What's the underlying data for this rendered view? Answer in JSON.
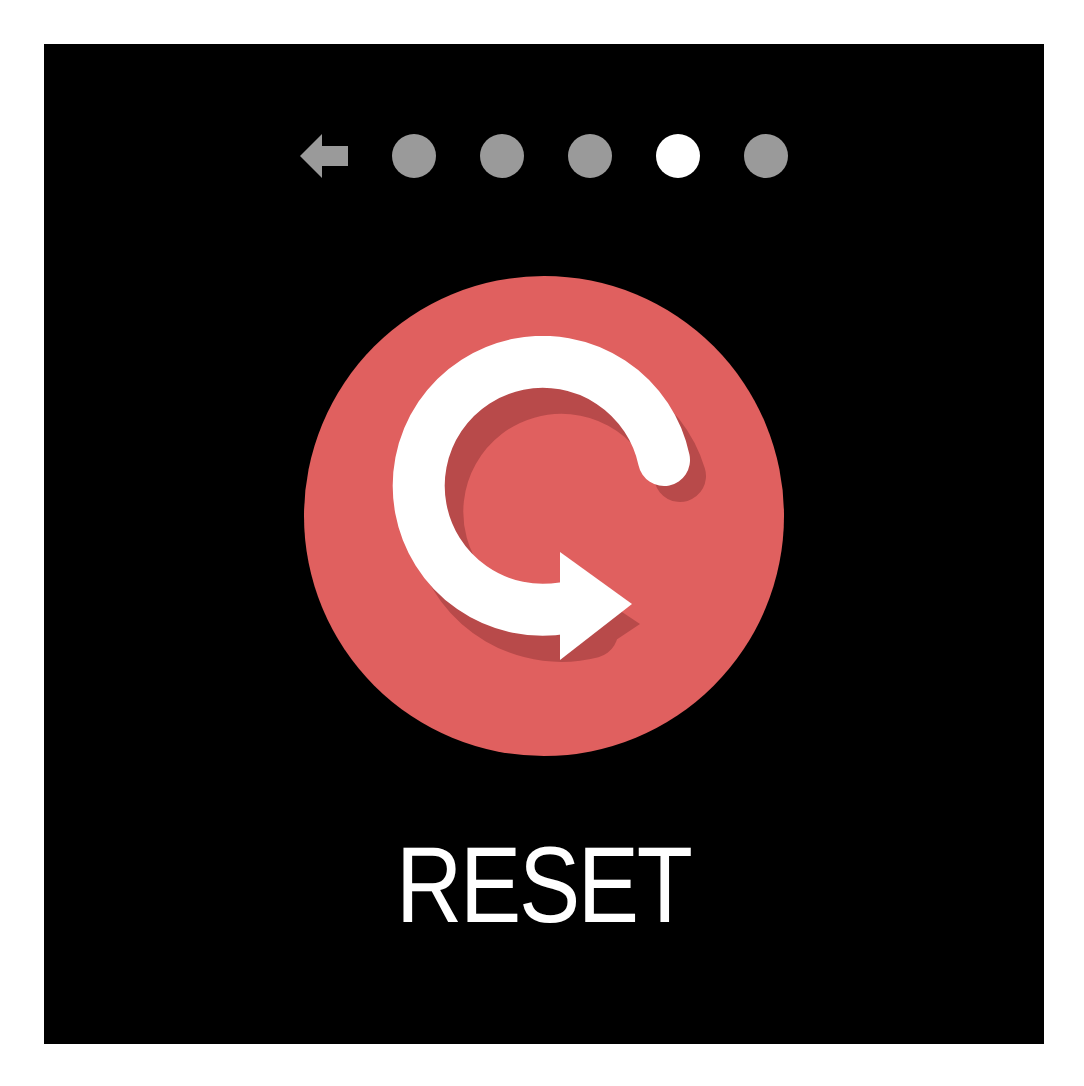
{
  "pager": {
    "dots": [
      {
        "selected": false
      },
      {
        "selected": false
      },
      {
        "selected": false
      },
      {
        "selected": true
      },
      {
        "selected": false
      }
    ]
  },
  "action": {
    "label": "RESET"
  }
}
